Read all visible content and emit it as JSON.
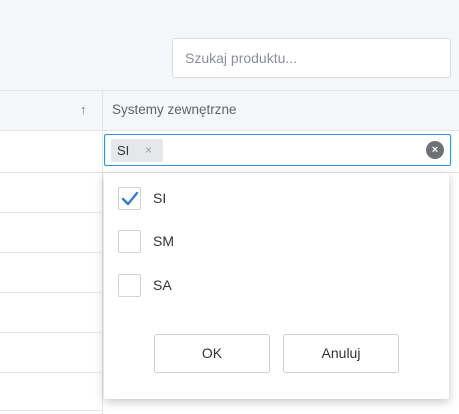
{
  "search": {
    "placeholder": "Szukaj produktu..."
  },
  "table": {
    "sort_indicator": "↑",
    "column_title": "Systemy zewnętrzne"
  },
  "filter": {
    "chip_label": "SI",
    "chip_remove": "×",
    "clear_label": "×"
  },
  "dropdown": {
    "options": [
      {
        "label": "SI",
        "checked": true
      },
      {
        "label": "SM",
        "checked": false
      },
      {
        "label": "SA",
        "checked": false
      }
    ],
    "ok_label": "OK",
    "cancel_label": "Anuluj"
  },
  "colors": {
    "accent": "#3c8dde",
    "check": "#2f7fd8"
  }
}
